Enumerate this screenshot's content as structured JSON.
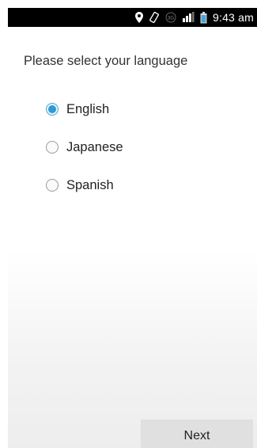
{
  "status_bar": {
    "time": "9:43 am",
    "icons": [
      "location-icon",
      "rotate-icon",
      "3g-icon",
      "signal-icon",
      "battery-icon"
    ],
    "network_label": "3G"
  },
  "screen": {
    "title": "Please select your language",
    "options": [
      {
        "label": "English",
        "checked": true
      },
      {
        "label": "Japanese",
        "checked": false
      },
      {
        "label": "Spanish",
        "checked": false
      }
    ],
    "next_label": "Next"
  },
  "colors": {
    "accent": "#2d9ad4",
    "status_bar": "#000000",
    "button_bg": "#e0e0e0"
  }
}
